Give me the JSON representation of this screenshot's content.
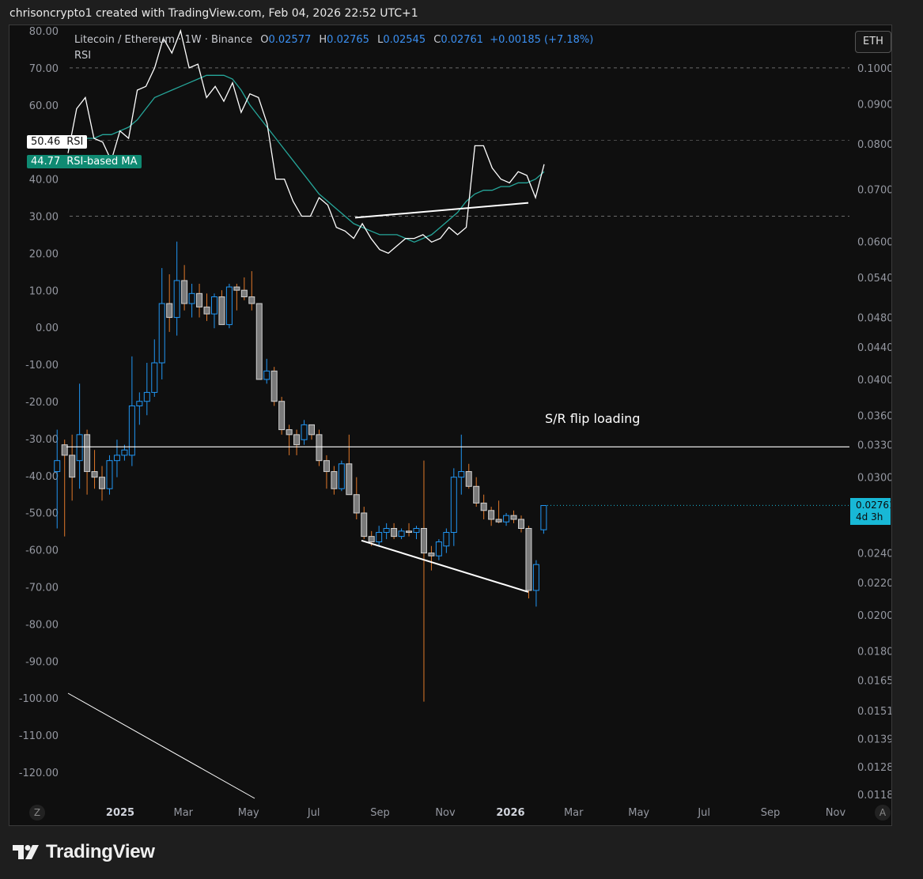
{
  "header": "chrisoncrypto1 created with TradingView.com, Feb 04, 2026 22:52 UTC+1",
  "legend": {
    "symbol": "Litecoin / Ethereum · 1W · Binance",
    "o_label": "O",
    "o": "0.02577",
    "h_label": "H",
    "h": "0.02765",
    "l_label": "L",
    "l": "0.02545",
    "c_label": "C",
    "c": "0.02761",
    "change": "+0.00185 (+7.18%)",
    "rsi_label": "RSI"
  },
  "currency_button": "ETH",
  "rsi_tag": {
    "value": "50.46",
    "label": "RSI"
  },
  "ma_tag": {
    "value": "44.77",
    "label": "RSI-based MA"
  },
  "price_tag": {
    "price": "0.02761",
    "countdown": "4d 3h"
  },
  "annotation": "S/R flip loading",
  "axis_buttons": {
    "left": "Z",
    "right": "A"
  },
  "brand": "TradingView",
  "colors": {
    "up": "#2196f3",
    "down": "#808080",
    "down_wick": "#e0782a",
    "rsi_line": "#ffffff",
    "rsi_ma": "#26a69a",
    "price_tag": "#18b8d6"
  },
  "chart_data": {
    "type": "candlestick",
    "title": "Litecoin / Ethereum · 1W · Binance",
    "left_axis": {
      "labels": [
        "80.00",
        "70.00",
        "60.00",
        "50.00",
        "40.00",
        "30.00",
        "20.00",
        "10.00",
        "0.00",
        "-10.00",
        "-20.00",
        "-30.00",
        "-40.00",
        "-50.00",
        "-60.00",
        "-70.00",
        "-80.00",
        "-90.00",
        "-100.00",
        "-110.00",
        "-120.00"
      ]
    },
    "right_axis": {
      "scale": "log",
      "labels": [
        "0.10000",
        "0.09000",
        "0.08000",
        "0.07000",
        "0.06000",
        "0.05400",
        "0.04800",
        "0.04400",
        "0.04000",
        "0.03600",
        "0.03300",
        "0.03000",
        "0.02400",
        "0.02200",
        "0.02000",
        "0.01800",
        "0.01650",
        "0.01510",
        "0.01390",
        "0.01280",
        "0.01180"
      ],
      "values": [
        0.1,
        0.09,
        0.08,
        0.07,
        0.06,
        0.054,
        0.048,
        0.044,
        0.04,
        0.036,
        0.033,
        0.03,
        0.024,
        0.022,
        0.02,
        0.018,
        0.0165,
        0.0151,
        0.0139,
        0.0128,
        0.0118
      ]
    },
    "x_axis": {
      "labels": [
        "2025",
        "Mar",
        "May",
        "Jul",
        "Sep",
        "Nov",
        "2026",
        "Mar",
        "May",
        "Jul",
        "Sep",
        "Nov"
      ],
      "bold": [
        "2025",
        "2026"
      ]
    },
    "rsi": {
      "levels": [
        70,
        30
      ],
      "rsi_values": [
        47,
        59,
        62,
        51,
        50,
        45,
        53,
        51,
        64,
        65,
        70,
        78,
        74,
        80,
        70,
        71,
        62,
        65,
        61,
        66,
        58,
        63,
        62,
        55,
        40,
        40,
        34,
        30,
        30,
        35,
        33,
        27,
        26,
        24,
        28,
        24,
        21,
        20,
        22,
        24,
        24,
        25,
        23,
        24,
        27,
        25,
        27,
        49,
        49,
        43,
        40,
        39,
        42,
        41,
        35,
        44
      ],
      "ma_values": [
        48,
        50,
        51,
        51,
        52,
        52,
        53,
        54,
        56,
        59,
        62,
        63,
        64,
        65,
        66,
        67,
        68,
        68,
        68,
        67,
        64,
        60,
        57,
        54,
        51,
        48,
        45,
        42,
        39,
        36,
        34,
        32,
        30,
        28,
        27,
        26,
        25,
        25,
        25,
        24,
        23,
        24,
        25,
        27,
        29,
        31,
        34,
        36,
        37,
        37,
        38,
        38,
        39,
        39,
        40,
        42
      ]
    },
    "candles": [
      {
        "d": "2024-11-03",
        "o": 0.0305,
        "h": 0.0345,
        "l": 0.0258,
        "c": 0.0315
      },
      {
        "d": "2024-11-10",
        "o": 0.033,
        "h": 0.0335,
        "l": 0.0252,
        "c": 0.032
      },
      {
        "d": "2024-11-17",
        "o": 0.032,
        "h": 0.034,
        "l": 0.028,
        "c": 0.03
      },
      {
        "d": "2024-11-24",
        "o": 0.0315,
        "h": 0.0395,
        "l": 0.029,
        "c": 0.034
      },
      {
        "d": "2024-12-01",
        "o": 0.034,
        "h": 0.0345,
        "l": 0.0285,
        "c": 0.0305
      },
      {
        "d": "2024-12-08",
        "o": 0.0305,
        "h": 0.0325,
        "l": 0.029,
        "c": 0.03
      },
      {
        "d": "2024-12-15",
        "o": 0.03,
        "h": 0.031,
        "l": 0.028,
        "c": 0.029
      },
      {
        "d": "2024-12-22",
        "o": 0.029,
        "h": 0.032,
        "l": 0.0285,
        "c": 0.0315
      },
      {
        "d": "2024-12-29",
        "o": 0.0315,
        "h": 0.0335,
        "l": 0.03,
        "c": 0.032
      },
      {
        "d": "2025-01-05",
        "o": 0.032,
        "h": 0.033,
        "l": 0.0315,
        "c": 0.0325
      },
      {
        "d": "2025-01-12",
        "o": 0.032,
        "h": 0.0428,
        "l": 0.031,
        "c": 0.037
      },
      {
        "d": "2025-01-19",
        "o": 0.037,
        "h": 0.0385,
        "l": 0.035,
        "c": 0.0375
      },
      {
        "d": "2025-01-26",
        "o": 0.0375,
        "h": 0.042,
        "l": 0.036,
        "c": 0.0385
      },
      {
        "d": "2025-02-02",
        "o": 0.0385,
        "h": 0.045,
        "l": 0.038,
        "c": 0.042
      },
      {
        "d": "2025-02-09",
        "o": 0.042,
        "h": 0.0555,
        "l": 0.04,
        "c": 0.05
      },
      {
        "d": "2025-02-16",
        "o": 0.05,
        "h": 0.0545,
        "l": 0.046,
        "c": 0.048
      },
      {
        "d": "2025-02-23",
        "o": 0.048,
        "h": 0.06,
        "l": 0.0455,
        "c": 0.0535
      },
      {
        "d": "2025-03-02",
        "o": 0.0535,
        "h": 0.056,
        "l": 0.049,
        "c": 0.05
      },
      {
        "d": "2025-03-09",
        "o": 0.05,
        "h": 0.053,
        "l": 0.048,
        "c": 0.0515
      },
      {
        "d": "2025-03-16",
        "o": 0.0515,
        "h": 0.053,
        "l": 0.048,
        "c": 0.0495
      },
      {
        "d": "2025-03-23",
        "o": 0.0495,
        "h": 0.0515,
        "l": 0.0475,
        "c": 0.0485
      },
      {
        "d": "2025-03-30",
        "o": 0.0485,
        "h": 0.0515,
        "l": 0.0465,
        "c": 0.051
      },
      {
        "d": "2025-04-06",
        "o": 0.051,
        "h": 0.052,
        "l": 0.047,
        "c": 0.047
      },
      {
        "d": "2025-04-13",
        "o": 0.047,
        "h": 0.053,
        "l": 0.0465,
        "c": 0.0525
      },
      {
        "d": "2025-04-20",
        "o": 0.0525,
        "h": 0.053,
        "l": 0.049,
        "c": 0.052
      },
      {
        "d": "2025-04-27",
        "o": 0.052,
        "h": 0.054,
        "l": 0.0505,
        "c": 0.051
      },
      {
        "d": "2025-05-04",
        "o": 0.051,
        "h": 0.055,
        "l": 0.049,
        "c": 0.05
      },
      {
        "d": "2025-05-11",
        "o": 0.05,
        "h": 0.05,
        "l": 0.04,
        "c": 0.04
      },
      {
        "d": "2025-05-18",
        "o": 0.04,
        "h": 0.0425,
        "l": 0.0395,
        "c": 0.041
      },
      {
        "d": "2025-05-25",
        "o": 0.041,
        "h": 0.0415,
        "l": 0.037,
        "c": 0.0375
      },
      {
        "d": "2025-06-01",
        "o": 0.0375,
        "h": 0.038,
        "l": 0.034,
        "c": 0.0345
      },
      {
        "d": "2025-06-08",
        "o": 0.0345,
        "h": 0.035,
        "l": 0.032,
        "c": 0.034
      },
      {
        "d": "2025-06-15",
        "o": 0.034,
        "h": 0.0345,
        "l": 0.032,
        "c": 0.033
      },
      {
        "d": "2025-06-22",
        "o": 0.0335,
        "h": 0.0355,
        "l": 0.033,
        "c": 0.035
      },
      {
        "d": "2025-06-29",
        "o": 0.035,
        "h": 0.035,
        "l": 0.0335,
        "c": 0.034
      },
      {
        "d": "2025-07-06",
        "o": 0.034,
        "h": 0.0345,
        "l": 0.031,
        "c": 0.0315
      },
      {
        "d": "2025-07-13",
        "o": 0.0315,
        "h": 0.032,
        "l": 0.029,
        "c": 0.0305
      },
      {
        "d": "2025-07-20",
        "o": 0.0305,
        "h": 0.031,
        "l": 0.0285,
        "c": 0.029
      },
      {
        "d": "2025-07-27",
        "o": 0.029,
        "h": 0.0315,
        "l": 0.0288,
        "c": 0.0312
      },
      {
        "d": "2025-08-03",
        "o": 0.0312,
        "h": 0.034,
        "l": 0.0285,
        "c": 0.0285
      },
      {
        "d": "2025-08-10",
        "o": 0.0285,
        "h": 0.03,
        "l": 0.0265,
        "c": 0.027
      },
      {
        "d": "2025-08-17",
        "o": 0.027,
        "h": 0.0275,
        "l": 0.025,
        "c": 0.0252
      },
      {
        "d": "2025-08-24",
        "o": 0.0252,
        "h": 0.0256,
        "l": 0.0245,
        "c": 0.0248
      },
      {
        "d": "2025-08-31",
        "o": 0.0248,
        "h": 0.026,
        "l": 0.0245,
        "c": 0.0255
      },
      {
        "d": "2025-09-07",
        "o": 0.0255,
        "h": 0.0262,
        "l": 0.025,
        "c": 0.0258
      },
      {
        "d": "2025-09-14",
        "o": 0.0258,
        "h": 0.0262,
        "l": 0.025,
        "c": 0.0252
      },
      {
        "d": "2025-09-21",
        "o": 0.0252,
        "h": 0.0258,
        "l": 0.025,
        "c": 0.0256
      },
      {
        "d": "2025-09-28",
        "o": 0.0256,
        "h": 0.0262,
        "l": 0.0252,
        "c": 0.0255
      },
      {
        "d": "2025-10-05",
        "o": 0.0255,
        "h": 0.026,
        "l": 0.025,
        "c": 0.0258
      },
      {
        "d": "2025-10-12",
        "o": 0.0258,
        "h": 0.0315,
        "l": 0.0155,
        "c": 0.024
      },
      {
        "d": "2025-10-19",
        "o": 0.024,
        "h": 0.0245,
        "l": 0.0228,
        "c": 0.0238
      },
      {
        "d": "2025-10-26",
        "o": 0.0238,
        "h": 0.025,
        "l": 0.0235,
        "c": 0.0248
      },
      {
        "d": "2025-11-02",
        "o": 0.0245,
        "h": 0.0258,
        "l": 0.024,
        "c": 0.0255
      },
      {
        "d": "2025-11-09",
        "o": 0.0255,
        "h": 0.0308,
        "l": 0.0245,
        "c": 0.03
      },
      {
        "d": "2025-11-16",
        "o": 0.03,
        "h": 0.034,
        "l": 0.0285,
        "c": 0.0305
      },
      {
        "d": "2025-11-23",
        "o": 0.0305,
        "h": 0.0312,
        "l": 0.029,
        "c": 0.0292
      },
      {
        "d": "2025-11-30",
        "o": 0.0292,
        "h": 0.03,
        "l": 0.0275,
        "c": 0.0278
      },
      {
        "d": "2025-12-07",
        "o": 0.0278,
        "h": 0.0285,
        "l": 0.0265,
        "c": 0.0272
      },
      {
        "d": "2025-12-14",
        "o": 0.0272,
        "h": 0.0275,
        "l": 0.026,
        "c": 0.0265
      },
      {
        "d": "2025-12-21",
        "o": 0.0265,
        "h": 0.028,
        "l": 0.0262,
        "c": 0.0263
      },
      {
        "d": "2025-12-28",
        "o": 0.0263,
        "h": 0.027,
        "l": 0.026,
        "c": 0.0268
      },
      {
        "d": "2026-01-04",
        "o": 0.0268,
        "h": 0.0272,
        "l": 0.0262,
        "c": 0.0265
      },
      {
        "d": "2026-01-11",
        "o": 0.0265,
        "h": 0.0268,
        "l": 0.0255,
        "c": 0.0258
      },
      {
        "d": "2026-01-18",
        "o": 0.0258,
        "h": 0.026,
        "l": 0.021,
        "c": 0.0215
      },
      {
        "d": "2026-01-25",
        "o": 0.0215,
        "h": 0.0235,
        "l": 0.0205,
        "c": 0.0232
      },
      {
        "d": "2026-02-01",
        "o": 0.0257,
        "h": 0.0276,
        "l": 0.0254,
        "c": 0.0276
      }
    ],
    "horizontal_line": 0.0328,
    "annotation": "S/R flip loading"
  }
}
